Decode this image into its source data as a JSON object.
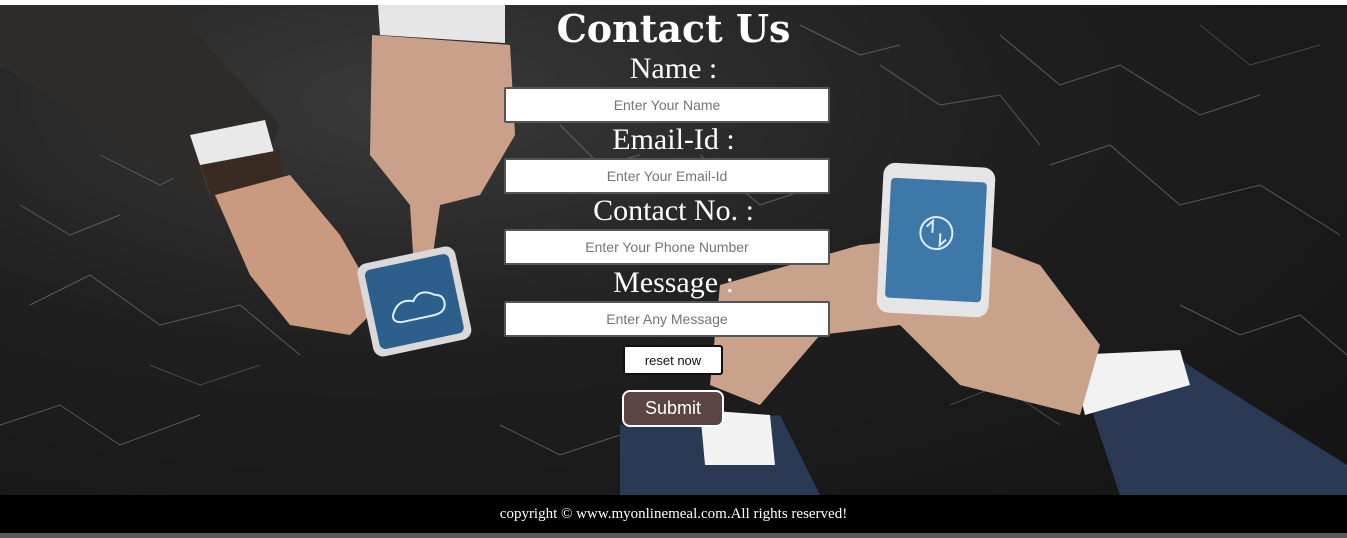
{
  "page": {
    "title": "Contact Us"
  },
  "form": {
    "name_label": "Name :",
    "name_placeholder": "Enter Your Name",
    "email_label": "Email-Id :",
    "email_placeholder": "Enter Your Email-Id",
    "phone_label": "Contact No. :",
    "phone_placeholder": "Enter Your Phone Number",
    "message_label": "Message :",
    "message_placeholder": "Enter Any Message",
    "reset_label": "reset now",
    "submit_label": "Submit"
  },
  "footer": {
    "copyright": "copyright © www.myonlinemeal.com.All rights reserved!"
  },
  "colors": {
    "submit_bg": "#5a4444",
    "footer_bg": "#000000",
    "text": "#ffffff"
  }
}
